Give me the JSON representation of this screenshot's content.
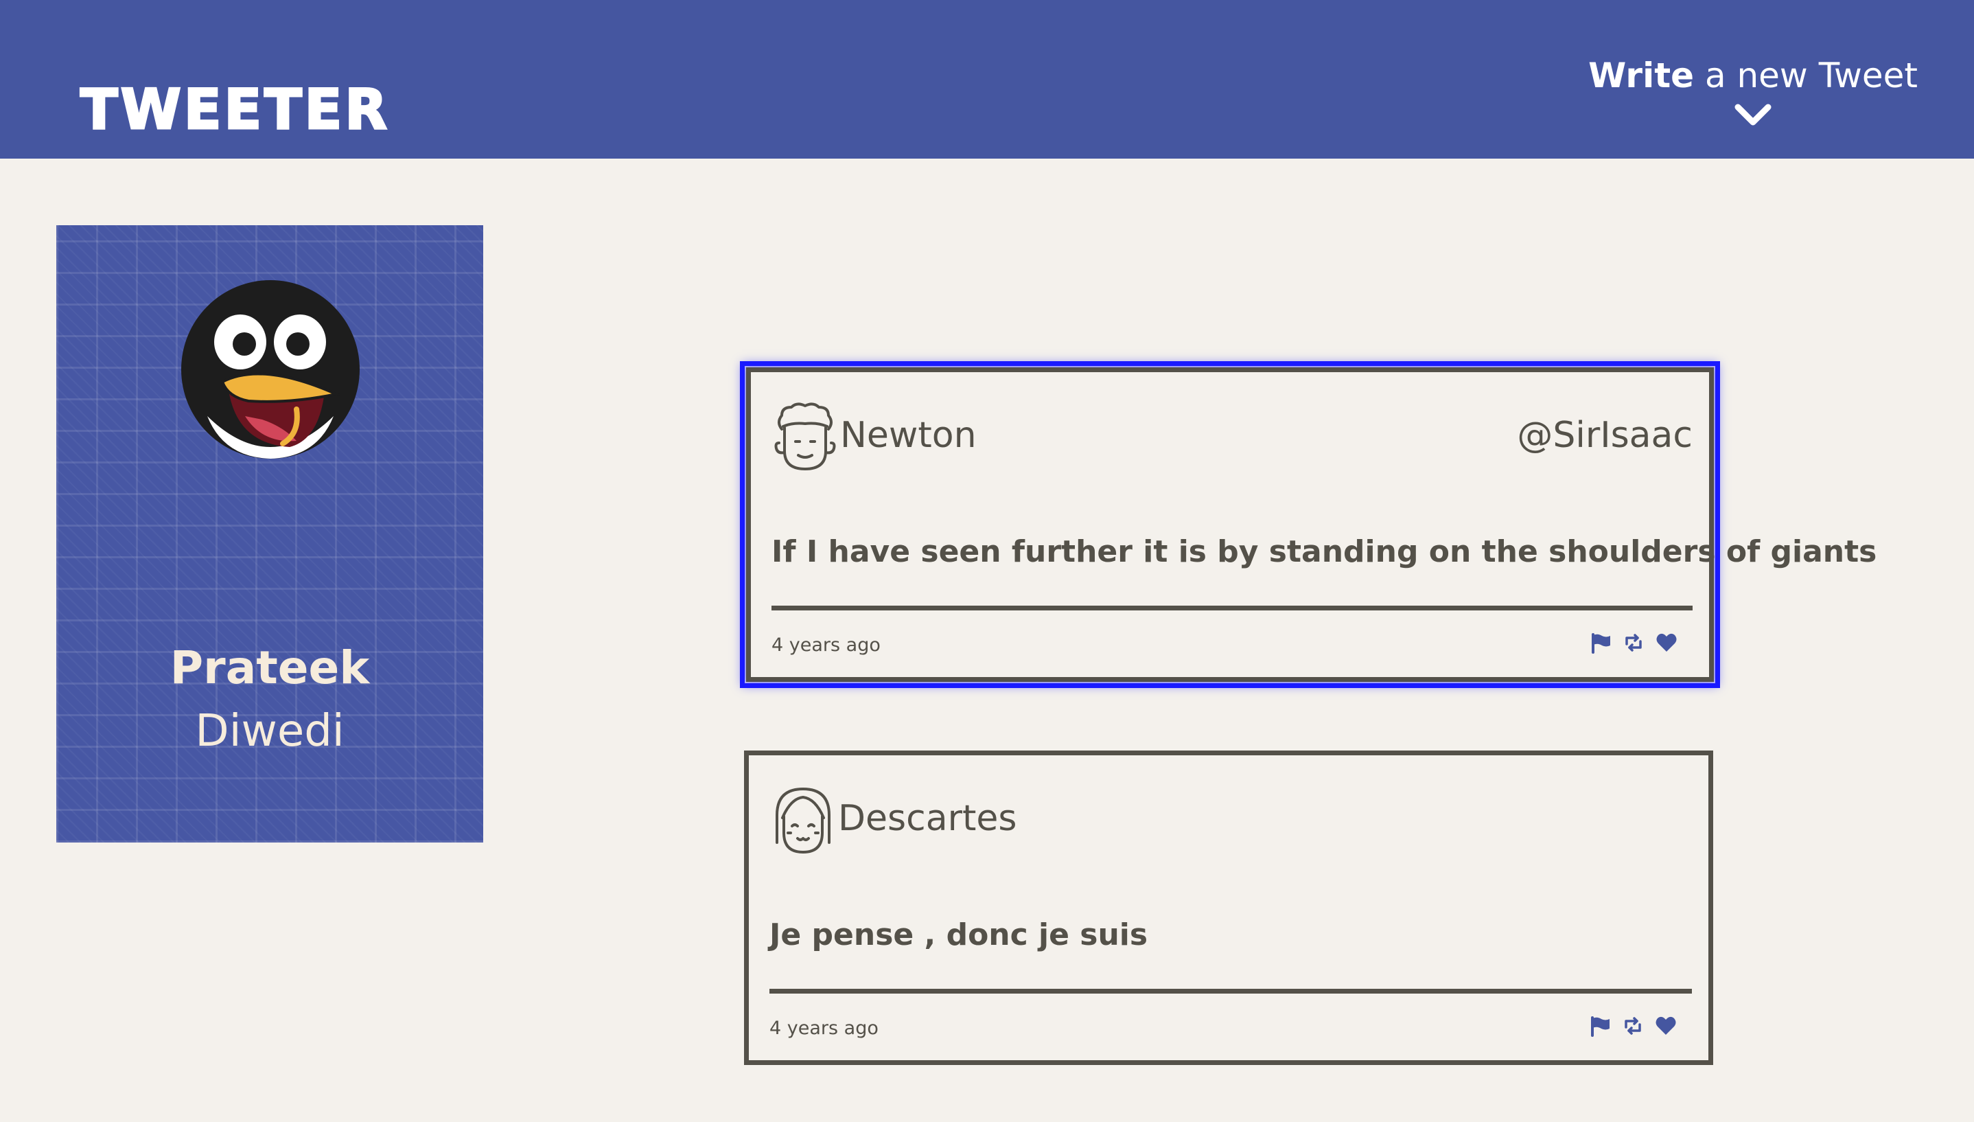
{
  "header": {
    "logo": "TWEETER",
    "compose_bold": "Write",
    "compose_rest": " a new Tweet",
    "compose_icon": "chevron-down-icon",
    "background": "#4556a0"
  },
  "profile": {
    "first_name": "Prateek",
    "last_name": "Diwedi",
    "avatar_icon": "penguin-avatar",
    "background": "#4757a4"
  },
  "tweets": [
    {
      "name": "Newton",
      "handle": "@SirIsaac",
      "content": "If I have seen further it is by standing on the shoulders of giants",
      "time": "4 years ago",
      "avatar_icon": "curly-hair-face-icon",
      "focused": true
    },
    {
      "name": "Descartes",
      "handle": "",
      "content": "Je pense , donc je suis",
      "time": "4 years ago",
      "avatar_icon": "bob-hair-face-icon",
      "focused": false
    }
  ],
  "colors": {
    "page_background": "#f4f1ec",
    "text": "#545149",
    "accent": "#4556a0",
    "focus_ring": "#1a1aff"
  }
}
